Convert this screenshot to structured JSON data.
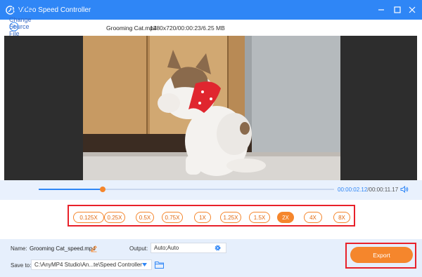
{
  "window": {
    "title": "Video Speed Controller",
    "accent": "#2f86f6"
  },
  "toolbar": {
    "change_source_label": "Change Source File",
    "file_name": "Grooming Cat.mp4",
    "file_meta": "1280x720/00:00:23/6.25 MB"
  },
  "player": {
    "current_time": "00:00:02.12",
    "total_time": "/00:00:11.17",
    "progress": 0.216
  },
  "speeds": {
    "options": [
      "0.125X",
      "0.25X",
      "0.5X",
      "0.75X",
      "1X",
      "1.25X",
      "1.5X",
      "2X",
      "4X",
      "8X"
    ],
    "selected": "2X",
    "accent": "#f5862c"
  },
  "output": {
    "name_label": "Name:",
    "name_value": "Grooming Cat_speed.mp4",
    "output_label": "Output:",
    "output_value": "Auto;Auto",
    "save_label": "Save to:",
    "save_value": "C:\\AnyMP4 Studio\\An...te\\Speed Controller",
    "export_label": "Export"
  }
}
